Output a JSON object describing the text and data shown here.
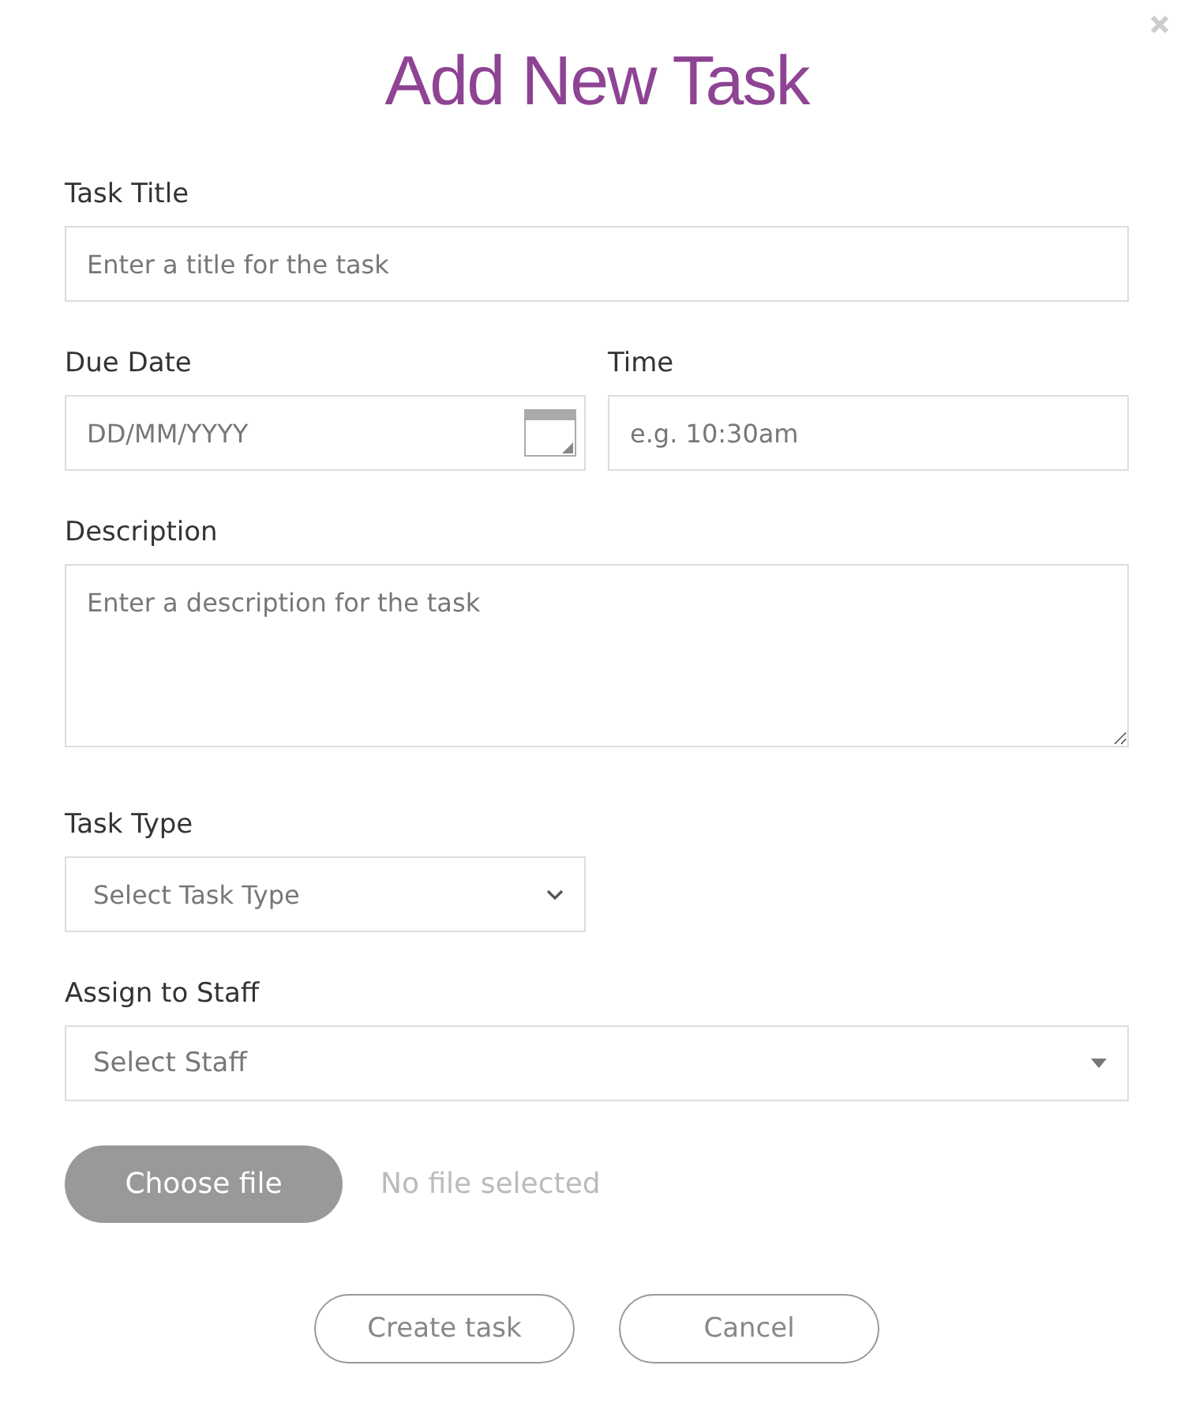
{
  "dialog": {
    "title": "Add New Task"
  },
  "rows": [
    {
      "fields": [
        {
          "kind": "text",
          "label": "Task Title",
          "placeholder": "Enter a title for the task"
        }
      ]
    },
    {
      "fields": [
        {
          "kind": "date",
          "label": "Due Date",
          "placeholder": "DD/MM/YYYY"
        },
        {
          "kind": "text",
          "label": "Time",
          "placeholder": "e.g. 10:30am"
        }
      ]
    },
    {
      "fields": [
        {
          "kind": "textarea",
          "label": "Description",
          "placeholder": "Enter a description for the task"
        }
      ]
    },
    {
      "fields": [
        {
          "kind": "select",
          "label": "Task Type",
          "value": "Select Task Type"
        },
        {
          "kind": "empty"
        }
      ]
    },
    {
      "fields": [
        {
          "kind": "dropdown",
          "label": "Assign to Staff",
          "value": "Select Staff"
        }
      ]
    }
  ],
  "file": {
    "button": "Choose file",
    "status": "No file selected"
  },
  "buttons": [
    "Create task",
    "Cancel"
  ]
}
